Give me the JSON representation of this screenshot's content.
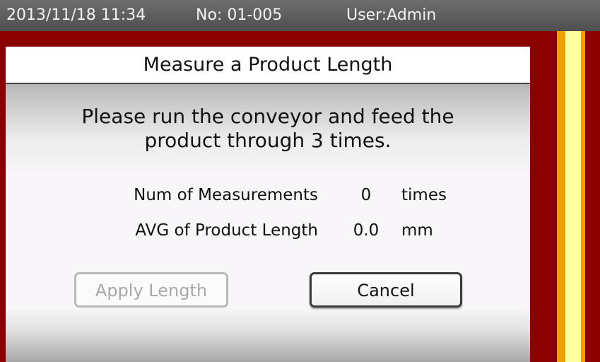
{
  "status_bar": {
    "datetime": "2013/11/18  11:34",
    "number": "No: 01-005",
    "user": "User:Admin"
  },
  "dialog": {
    "title": "Measure a Product Length",
    "message_line1": "Please run the conveyor and feed the",
    "message_line2": "product through 3 times.",
    "measurements": {
      "label": "Num of Measurements",
      "value": "0",
      "unit": "times"
    },
    "avg_length": {
      "label": "AVG of Product Length",
      "value": "0.0",
      "unit": "mm"
    },
    "apply_button": "Apply Length",
    "cancel_button": "Cancel"
  },
  "colors": {
    "background": "#8a0000",
    "stripe_orange": "#f0a000",
    "stripe_yellow": "#ffffa0",
    "status_bar": "#5a5a5a"
  }
}
